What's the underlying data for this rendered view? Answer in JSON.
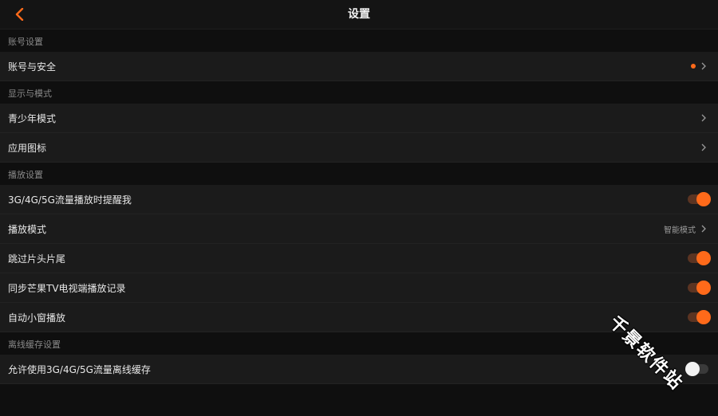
{
  "header": {
    "title": "设置",
    "back_icon": "chevron-left-icon"
  },
  "colors": {
    "accent": "#ff6a1a",
    "background": "#0f0f0f",
    "row": "#1b1b1b"
  },
  "sections": [
    {
      "title": "账号设置",
      "items": [
        {
          "label": "账号与安全",
          "type": "link",
          "badge": true
        }
      ]
    },
    {
      "title": "显示与模式",
      "items": [
        {
          "label": "青少年模式",
          "type": "link"
        },
        {
          "label": "应用图标",
          "type": "link"
        }
      ]
    },
    {
      "title": "播放设置",
      "items": [
        {
          "label": "3G/4G/5G流量播放时提醒我",
          "type": "toggle",
          "on": true
        },
        {
          "label": "播放模式",
          "type": "link",
          "value": "智能模式"
        },
        {
          "label": "跳过片头片尾",
          "type": "toggle",
          "on": true
        },
        {
          "label": "同步芒果TV电视端播放记录",
          "type": "toggle",
          "on": true
        },
        {
          "label": "自动小窗播放",
          "type": "toggle",
          "on": true
        }
      ]
    },
    {
      "title": "离线缓存设置",
      "items": [
        {
          "label": "允许使用3G/4G/5G流量离线缓存",
          "type": "toggle",
          "on": false
        }
      ]
    }
  ],
  "watermark": "千景软件站"
}
